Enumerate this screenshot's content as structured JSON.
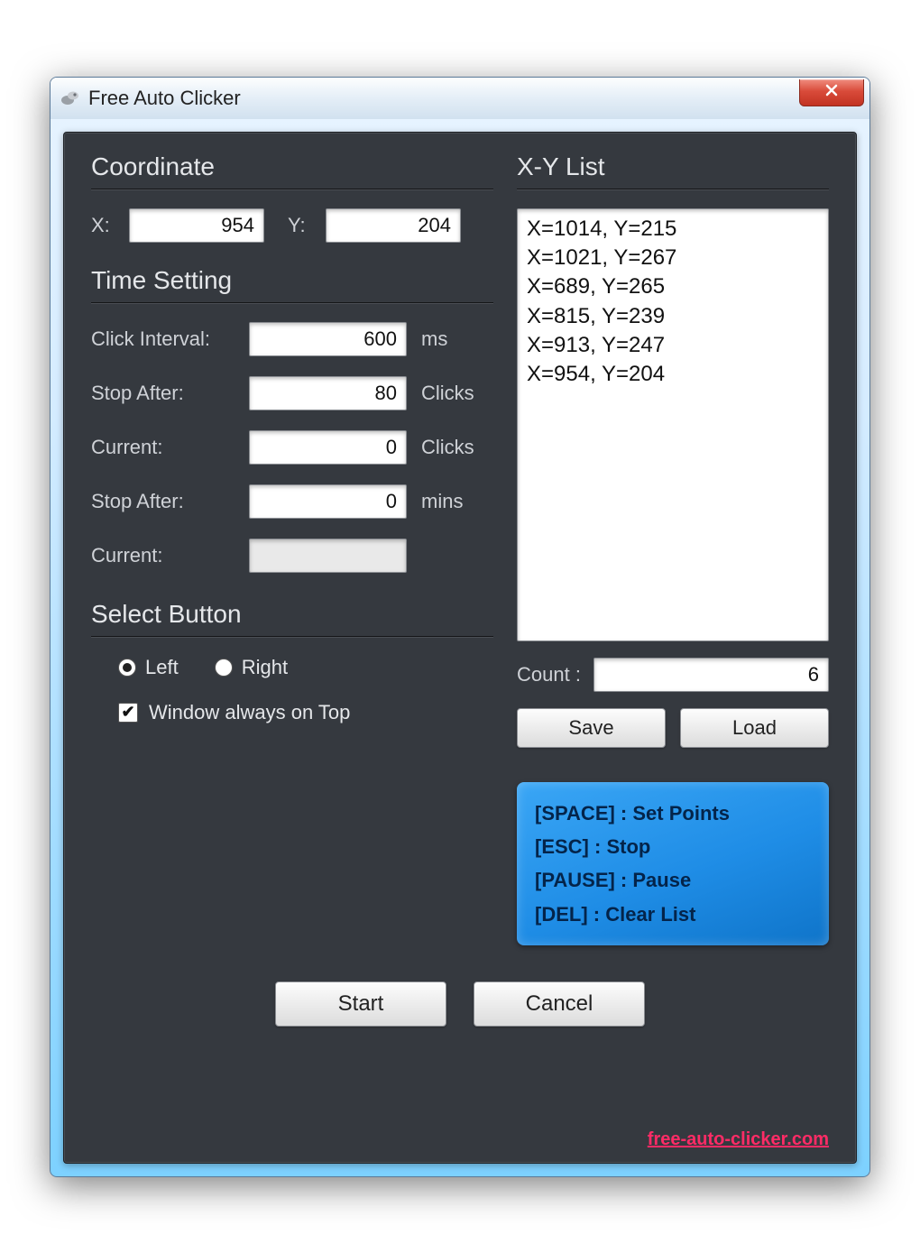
{
  "window": {
    "title": "Free Auto Clicker"
  },
  "coordinate": {
    "title": "Coordinate",
    "x_label": "X:",
    "x_value": "954",
    "y_label": "Y:",
    "y_value": "204"
  },
  "time_setting": {
    "title": "Time Setting",
    "click_interval_label": "Click Interval:",
    "click_interval_value": "600",
    "click_interval_unit": "ms",
    "stop_after_clicks_label": "Stop After:",
    "stop_after_clicks_value": "80",
    "stop_after_clicks_unit": "Clicks",
    "current_clicks_label": "Current:",
    "current_clicks_value": "0",
    "current_clicks_unit": "Clicks",
    "stop_after_mins_label": "Stop After:",
    "stop_after_mins_value": "0",
    "stop_after_mins_unit": "mins",
    "current_time_label": "Current:",
    "current_time_value": ""
  },
  "select_button": {
    "title": "Select Button",
    "left_label": "Left",
    "right_label": "Right",
    "selected": "left",
    "always_on_top_label": "Window always on Top",
    "always_on_top_checked": true
  },
  "xy_list": {
    "title": "X-Y List",
    "items": [
      "X=1014, Y=215",
      "X=1021, Y=267",
      "X=689, Y=265",
      "X=815, Y=239",
      "X=913, Y=247",
      "X=954, Y=204"
    ],
    "count_label": "Count :",
    "count_value": "6",
    "save_label": "Save",
    "load_label": "Load"
  },
  "hints": {
    "space": "[SPACE] : Set Points",
    "esc": "[ESC] : Stop",
    "pause": "[PAUSE] : Pause",
    "del": "[DEL] : Clear List"
  },
  "actions": {
    "start": "Start",
    "cancel": "Cancel"
  },
  "footer": {
    "link_text": "free-auto-clicker.com"
  }
}
